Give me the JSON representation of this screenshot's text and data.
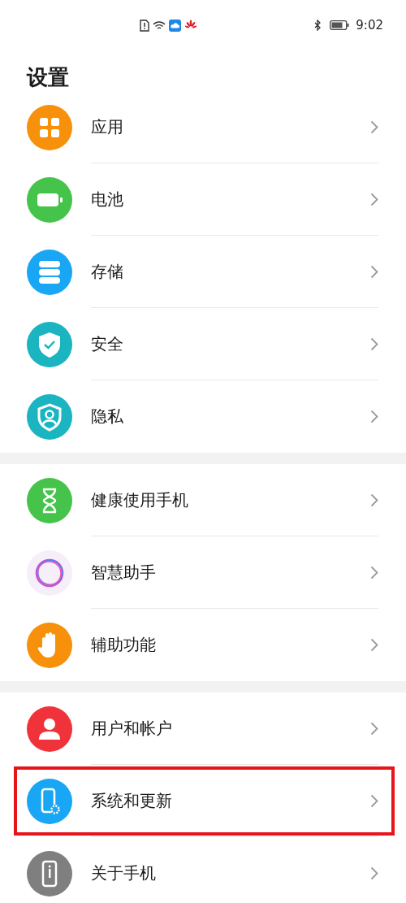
{
  "status_bar": {
    "time": "9:02"
  },
  "title": "设置",
  "groups": [
    {
      "items": [
        {
          "label": "应用",
          "color": "#f7900a",
          "highlighted": false
        },
        {
          "label": "电池",
          "color": "#45c34a",
          "highlighted": false
        },
        {
          "label": "存储",
          "color": "#19a6f5",
          "highlighted": false
        },
        {
          "label": "安全",
          "color": "#1ab5c0",
          "highlighted": false
        },
        {
          "label": "隐私",
          "color": "#1ab5c0",
          "highlighted": false
        }
      ]
    },
    {
      "items": [
        {
          "label": "健康使用手机",
          "color": "#45c34a",
          "highlighted": false
        },
        {
          "label": "智慧助手",
          "color": "#f6eef8",
          "highlighted": false
        },
        {
          "label": "辅助功能",
          "color": "#f7900a",
          "highlighted": false
        }
      ]
    },
    {
      "items": [
        {
          "label": "用户和帐户",
          "color": "#f0333b",
          "highlighted": false
        },
        {
          "label": "系统和更新",
          "color": "#19a6f5",
          "highlighted": true
        },
        {
          "label": "关于手机",
          "color": "#7f7f7f",
          "highlighted": false
        }
      ]
    }
  ]
}
